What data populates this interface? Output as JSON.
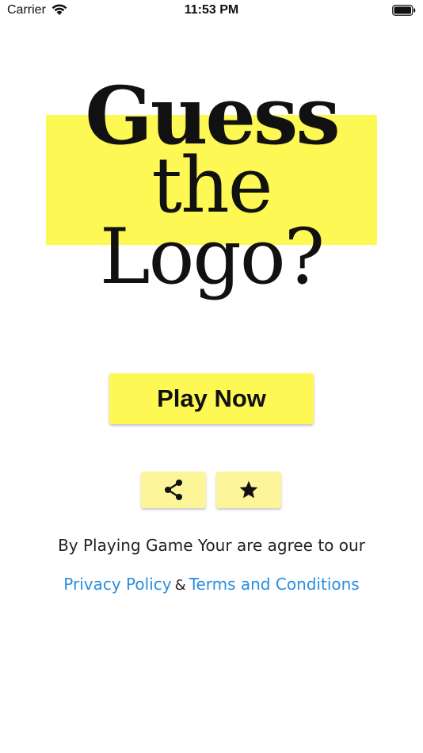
{
  "status_bar": {
    "carrier": "Carrier",
    "time": "11:53 PM",
    "icons": [
      "wifi-icon",
      "battery-icon"
    ]
  },
  "title": {
    "line1": "Guess",
    "line2": "the",
    "line3": "Logo?",
    "highlight_color": "#fdf853"
  },
  "actions": {
    "play_label": "Play Now",
    "share_icon": "share-icon",
    "rate_icon": "star-icon",
    "button_color": "#fdf853",
    "small_button_color": "#fdf59a"
  },
  "footer": {
    "agree_text": "By Playing Game Your are agree to our",
    "privacy_label": "Privacy Policy",
    "ampersand": "&",
    "terms_label": "Terms and Conditions",
    "link_color": "#2a8ee0"
  }
}
